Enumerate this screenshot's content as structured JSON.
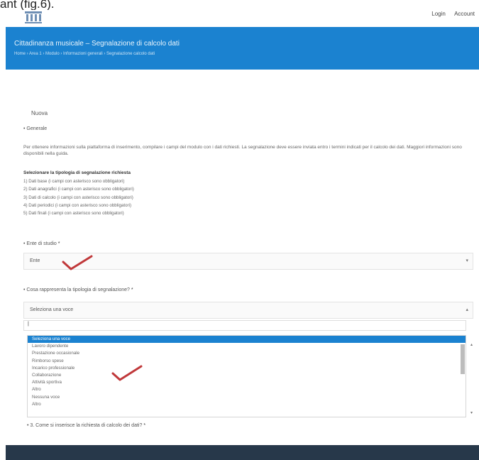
{
  "caption": "ant (fig.6).",
  "top_links": [
    "Login",
    "Account"
  ],
  "banner": {
    "title": "Cittadinanza musicale – Segnalazione di calcolo dati",
    "breadcrumbs": "Home › Area 1 › Modulo › Informazioni generali › Segnalazione calcolo dati"
  },
  "page": {
    "section_heading": "Nuova",
    "subheading": "• Generale",
    "intro": "Per ottenere informazioni sulla piattaforma di inserimento, compilare i campi del modulo con i dati richiesti. La segnalazione deve essere inviata entro i termini indicati per il calcolo dei dati. Maggiori informazioni sono disponibili nella guida.",
    "instructions_title": "Selezionare la tipologia di segnalazione richiesta",
    "instructions": [
      "1) Dati base (i campi con asterisco sono obbligatori)",
      "2) Dati anagrafici (i campi con asterisco sono obbligatori)",
      "3) Dati di calcolo (i campi con asterisco sono obbligatori)",
      "4) Dati periodici (i campi con asterisco sono obbligatori)",
      "5) Dati finali (i campi con asterisco sono obbligatori)"
    ]
  },
  "form": {
    "field1": {
      "label": "• Ente di studio",
      "required_mark": "*",
      "value": "Ente"
    },
    "field2": {
      "label": "• Cosa rappresenta la tipologia di segnalazione?",
      "required_mark": "*",
      "value": "Seleziona una voce"
    },
    "search_value": "|",
    "options": [
      "Seleziona una voce",
      "Lavoro dipendente",
      "Prestazione occasionale",
      "Rimborso spese",
      "Incarico professionale",
      "Collaborazione",
      "Attività sportiva",
      "Altro",
      "Nessuna voce",
      "Altro"
    ],
    "selected_index": 0,
    "field3": {
      "label": "• 3. Come si inserisce la richiesta di calcolo dei dati?",
      "required_mark": "*"
    }
  },
  "colors": {
    "accent": "#1b82d0",
    "footer": "#27384a",
    "check": "#c0383a"
  }
}
